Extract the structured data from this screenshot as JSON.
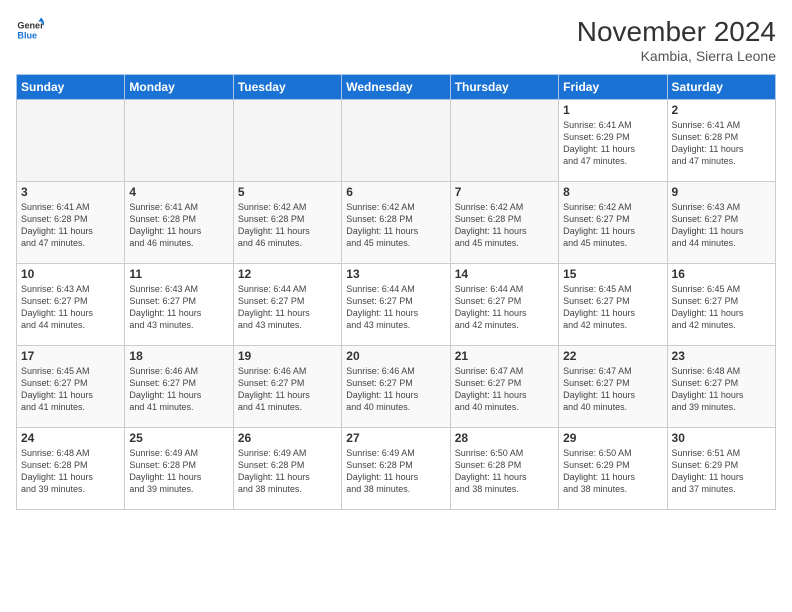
{
  "header": {
    "logo_line1": "General",
    "logo_line2": "Blue",
    "month_title": "November 2024",
    "subtitle": "Kambia, Sierra Leone"
  },
  "weekdays": [
    "Sunday",
    "Monday",
    "Tuesday",
    "Wednesday",
    "Thursday",
    "Friday",
    "Saturday"
  ],
  "weeks": [
    [
      {
        "day": "",
        "info": ""
      },
      {
        "day": "",
        "info": ""
      },
      {
        "day": "",
        "info": ""
      },
      {
        "day": "",
        "info": ""
      },
      {
        "day": "",
        "info": ""
      },
      {
        "day": "1",
        "info": "Sunrise: 6:41 AM\nSunset: 6:29 PM\nDaylight: 11 hours\nand 47 minutes."
      },
      {
        "day": "2",
        "info": "Sunrise: 6:41 AM\nSunset: 6:28 PM\nDaylight: 11 hours\nand 47 minutes."
      }
    ],
    [
      {
        "day": "3",
        "info": "Sunrise: 6:41 AM\nSunset: 6:28 PM\nDaylight: 11 hours\nand 47 minutes."
      },
      {
        "day": "4",
        "info": "Sunrise: 6:41 AM\nSunset: 6:28 PM\nDaylight: 11 hours\nand 46 minutes."
      },
      {
        "day": "5",
        "info": "Sunrise: 6:42 AM\nSunset: 6:28 PM\nDaylight: 11 hours\nand 46 minutes."
      },
      {
        "day": "6",
        "info": "Sunrise: 6:42 AM\nSunset: 6:28 PM\nDaylight: 11 hours\nand 45 minutes."
      },
      {
        "day": "7",
        "info": "Sunrise: 6:42 AM\nSunset: 6:28 PM\nDaylight: 11 hours\nand 45 minutes."
      },
      {
        "day": "8",
        "info": "Sunrise: 6:42 AM\nSunset: 6:27 PM\nDaylight: 11 hours\nand 45 minutes."
      },
      {
        "day": "9",
        "info": "Sunrise: 6:43 AM\nSunset: 6:27 PM\nDaylight: 11 hours\nand 44 minutes."
      }
    ],
    [
      {
        "day": "10",
        "info": "Sunrise: 6:43 AM\nSunset: 6:27 PM\nDaylight: 11 hours\nand 44 minutes."
      },
      {
        "day": "11",
        "info": "Sunrise: 6:43 AM\nSunset: 6:27 PM\nDaylight: 11 hours\nand 43 minutes."
      },
      {
        "day": "12",
        "info": "Sunrise: 6:44 AM\nSunset: 6:27 PM\nDaylight: 11 hours\nand 43 minutes."
      },
      {
        "day": "13",
        "info": "Sunrise: 6:44 AM\nSunset: 6:27 PM\nDaylight: 11 hours\nand 43 minutes."
      },
      {
        "day": "14",
        "info": "Sunrise: 6:44 AM\nSunset: 6:27 PM\nDaylight: 11 hours\nand 42 minutes."
      },
      {
        "day": "15",
        "info": "Sunrise: 6:45 AM\nSunset: 6:27 PM\nDaylight: 11 hours\nand 42 minutes."
      },
      {
        "day": "16",
        "info": "Sunrise: 6:45 AM\nSunset: 6:27 PM\nDaylight: 11 hours\nand 42 minutes."
      }
    ],
    [
      {
        "day": "17",
        "info": "Sunrise: 6:45 AM\nSunset: 6:27 PM\nDaylight: 11 hours\nand 41 minutes."
      },
      {
        "day": "18",
        "info": "Sunrise: 6:46 AM\nSunset: 6:27 PM\nDaylight: 11 hours\nand 41 minutes."
      },
      {
        "day": "19",
        "info": "Sunrise: 6:46 AM\nSunset: 6:27 PM\nDaylight: 11 hours\nand 41 minutes."
      },
      {
        "day": "20",
        "info": "Sunrise: 6:46 AM\nSunset: 6:27 PM\nDaylight: 11 hours\nand 40 minutes."
      },
      {
        "day": "21",
        "info": "Sunrise: 6:47 AM\nSunset: 6:27 PM\nDaylight: 11 hours\nand 40 minutes."
      },
      {
        "day": "22",
        "info": "Sunrise: 6:47 AM\nSunset: 6:27 PM\nDaylight: 11 hours\nand 40 minutes."
      },
      {
        "day": "23",
        "info": "Sunrise: 6:48 AM\nSunset: 6:27 PM\nDaylight: 11 hours\nand 39 minutes."
      }
    ],
    [
      {
        "day": "24",
        "info": "Sunrise: 6:48 AM\nSunset: 6:28 PM\nDaylight: 11 hours\nand 39 minutes."
      },
      {
        "day": "25",
        "info": "Sunrise: 6:49 AM\nSunset: 6:28 PM\nDaylight: 11 hours\nand 39 minutes."
      },
      {
        "day": "26",
        "info": "Sunrise: 6:49 AM\nSunset: 6:28 PM\nDaylight: 11 hours\nand 38 minutes."
      },
      {
        "day": "27",
        "info": "Sunrise: 6:49 AM\nSunset: 6:28 PM\nDaylight: 11 hours\nand 38 minutes."
      },
      {
        "day": "28",
        "info": "Sunrise: 6:50 AM\nSunset: 6:28 PM\nDaylight: 11 hours\nand 38 minutes."
      },
      {
        "day": "29",
        "info": "Sunrise: 6:50 AM\nSunset: 6:29 PM\nDaylight: 11 hours\nand 38 minutes."
      },
      {
        "day": "30",
        "info": "Sunrise: 6:51 AM\nSunset: 6:29 PM\nDaylight: 11 hours\nand 37 minutes."
      }
    ]
  ]
}
